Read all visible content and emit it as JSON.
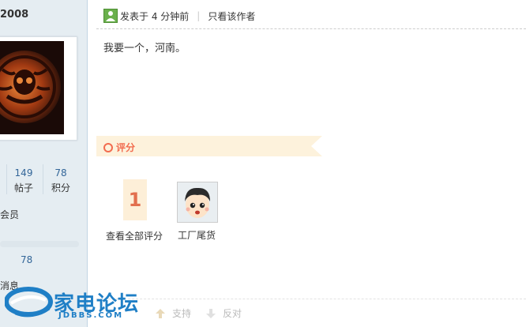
{
  "sidebar": {
    "username": "2008",
    "stats": [
      {
        "value": "149",
        "label": "帖子"
      },
      {
        "value": "78",
        "label": "积分"
      }
    ],
    "member_label": "会员",
    "progress_value": "78",
    "message_link": "消息"
  },
  "post": {
    "posted_time": "发表于 4 分钟前",
    "author_only": "只看该作者",
    "content": "我要一个，河南。"
  },
  "rating": {
    "section_label": "评分",
    "score": "1",
    "view_all": "查看全部评分",
    "rater_name": "工厂尾货"
  },
  "actions": {
    "support": "支持",
    "against": "反对"
  },
  "watermark": {
    "text": "家电论坛",
    "sub": "JDBBS.COM"
  },
  "colors": {
    "sidebar_bg": "#e5edf2",
    "accent": "#f26c4f",
    "link": "#336699"
  }
}
